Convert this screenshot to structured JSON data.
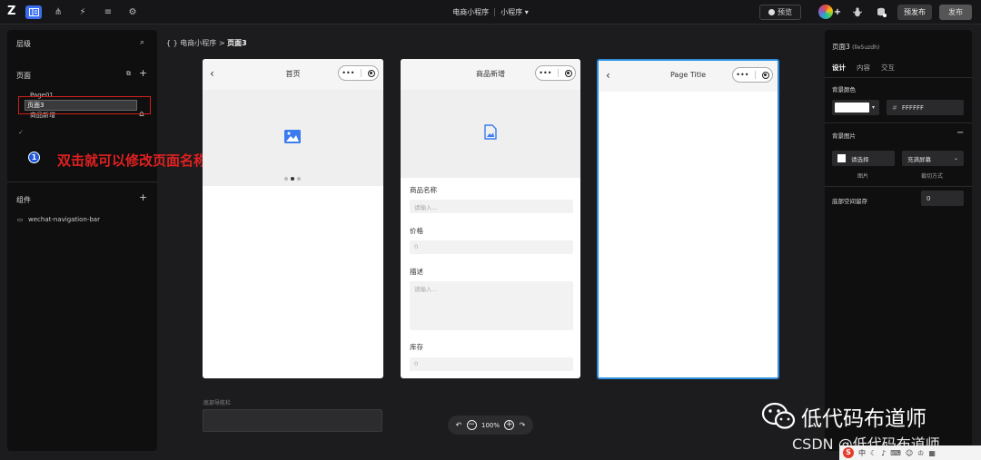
{
  "topbar": {
    "logo": "Z",
    "app_title": "电商小程序",
    "env_label": "小程序",
    "env_chevron": "▾",
    "preview_label": "预览",
    "pre_release_label": "预发布",
    "publish_label": "发布"
  },
  "left_panel": {
    "layers_title": "层级",
    "pages_title": "页面",
    "pages": [
      {
        "label": "Page01"
      },
      {
        "label": "商品新增"
      },
      {
        "label": "页面3",
        "editing": true
      }
    ],
    "components_title": "组件",
    "components": [
      {
        "label": "wechat-navigation-bar"
      }
    ]
  },
  "annotation": {
    "number": "1",
    "text": "双击就可以修改页面名称",
    "color": "#e02020"
  },
  "canvas": {
    "breadcrumb_prefix": "{ }",
    "breadcrumb_app": "电商小程序",
    "breadcrumb_sep": ">",
    "breadcrumb_page": "页面3",
    "phones": [
      {
        "title": "首页"
      },
      {
        "title": "商品新增",
        "fields": [
          {
            "label": "商品名称",
            "placeholder": "请输入..."
          },
          {
            "label": "价格",
            "placeholder": "0"
          },
          {
            "label": "描述",
            "placeholder": "请输入..."
          },
          {
            "label": "库存",
            "placeholder": "0"
          }
        ]
      },
      {
        "title": "Page Title"
      }
    ],
    "tabbar_label": "底部导航栏",
    "zoom": "100%"
  },
  "right_panel": {
    "page_name": "页面3",
    "page_id": "(lle5uzdh)",
    "tabs": [
      "设计",
      "内容",
      "交互"
    ],
    "bg_color_title": "背景颜色",
    "bg_color_hash": "#",
    "bg_color_value": "FFFFFF",
    "bg_image_title": "背景图片",
    "choose_image": "请选择",
    "fill_mode": "充满屏幕",
    "image_caption": "图片",
    "crop_caption": "裁切方式",
    "bottom_space_title": "底部空间留存",
    "bottom_space_value": "0",
    "accent": "#3a6df0"
  },
  "watermark": {
    "wechat_name": "低代码布道师",
    "csdn_text": "CSDN @低代码布道师"
  }
}
